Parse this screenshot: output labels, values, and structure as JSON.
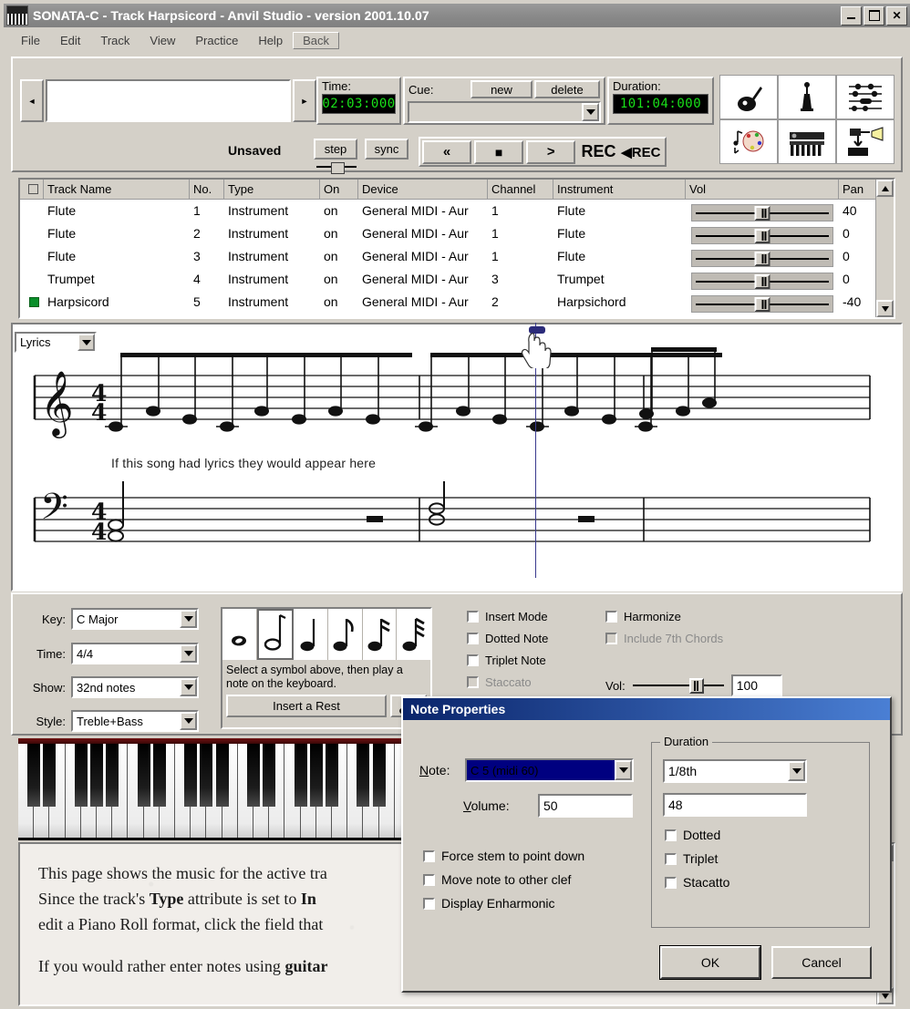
{
  "window": {
    "title": "SONATA-C - Track Harpsicord - Anvil Studio - version 2001.10.07",
    "icon": "piano-keyboard-icon",
    "minimize": "_",
    "maximize": "□",
    "close": "×"
  },
  "menu": {
    "items": [
      "File",
      "Edit",
      "Track",
      "View",
      "Practice",
      "Help"
    ],
    "back": "Back"
  },
  "toolbar": {
    "nav_prev": "◄",
    "nav_next": "►",
    "nav_value": "",
    "time_label": "Time:",
    "time_value": "02:03:000",
    "cue_label": "Cue:",
    "cue_new": "new",
    "cue_delete": "delete",
    "cue_value": "",
    "duration_label": "Duration:",
    "duration_value": "101:04:000",
    "unsaved": "Unsaved",
    "step": "step",
    "sync": "sync",
    "rewind": "«",
    "stop": "■",
    "play": ">",
    "rec": "REC",
    "rec_from_start": "◀REC",
    "icons": [
      "guitar-icon",
      "metronome-icon",
      "mixer-icon",
      "notes-palette-icon",
      "keyboard-icon",
      "export-icon"
    ]
  },
  "track_table": {
    "columns": [
      "",
      "Track Name",
      "No.",
      "Type",
      "On",
      "Device",
      "Channel",
      "Instrument",
      "Vol",
      "Pan"
    ],
    "rows": [
      {
        "active": false,
        "name": "Flute",
        "no": "1",
        "type": "Instrument",
        "on": "on",
        "device": "General MIDI - Aur",
        "channel": "1",
        "instrument": "Flute",
        "vol": 64,
        "pan": "40"
      },
      {
        "active": false,
        "name": "Flute",
        "no": "2",
        "type": "Instrument",
        "on": "on",
        "device": "General MIDI - Aur",
        "channel": "1",
        "instrument": "Flute",
        "vol": 64,
        "pan": "0"
      },
      {
        "active": false,
        "name": "Flute",
        "no": "3",
        "type": "Instrument",
        "on": "on",
        "device": "General MIDI - Aur",
        "channel": "1",
        "instrument": "Flute",
        "vol": 64,
        "pan": "0"
      },
      {
        "active": false,
        "name": "Trumpet",
        "no": "4",
        "type": "Instrument",
        "on": "on",
        "device": "General MIDI - Aur",
        "channel": "3",
        "instrument": "Trumpet",
        "vol": 64,
        "pan": "0"
      },
      {
        "active": true,
        "name": "Harpsicord",
        "no": "5",
        "type": "Instrument",
        "on": "on",
        "device": "General MIDI - Aur",
        "channel": "2",
        "instrument": "Harpsichord",
        "vol": 64,
        "pan": "-40"
      }
    ]
  },
  "score": {
    "view_select": "Lyrics",
    "lyrics": "If   this  song  had  lyrics  they  would  appear   here",
    "treble_clef": "treble-clef",
    "bass_clef": "bass-clef",
    "time_signature": "4/4",
    "cursor": "hand-cursor"
  },
  "controls": {
    "key_label": "Key:",
    "key_value": "C Major",
    "time_label": "Time:",
    "time_value": "4/4",
    "show_label": "Show:",
    "show_value": "32nd notes",
    "style_label": "Style:",
    "style_value": "Treble+Bass",
    "symbol_hint": "Select a symbol above, then play a note on the keyboard.",
    "insert_rest": "Insert a Rest",
    "symbols": [
      "whole-note",
      "half-note",
      "quarter-note",
      "eighth-note",
      "sixteenth-note",
      "thirtysecond-note"
    ],
    "selected_symbol_index": 1,
    "checkboxes_left": [
      {
        "label": "Insert Mode",
        "checked": false,
        "disabled": false
      },
      {
        "label": "Dotted Note",
        "checked": false,
        "disabled": false
      },
      {
        "label": "Triplet Note",
        "checked": false,
        "disabled": false
      },
      {
        "label": "Staccato",
        "checked": false,
        "disabled": true
      }
    ],
    "checkboxes_right": [
      {
        "label": "Harmonize",
        "checked": false,
        "disabled": false
      },
      {
        "label": "Include 7th Chords",
        "checked": false,
        "disabled": true
      }
    ],
    "vol_label": "Vol:",
    "vol_value": "100"
  },
  "dialog": {
    "title": "Note Properties",
    "note_label": "Note:",
    "note_value": "C 5 (midi 60)",
    "volume_label": "Volume:",
    "volume_value": "50",
    "duration_group": "Duration",
    "duration_value": "1/8th",
    "ticks_value": "48",
    "duration_checks": [
      {
        "label": "Dotted",
        "checked": false
      },
      {
        "label": "Triplet",
        "checked": false
      },
      {
        "label": "Stacatto",
        "checked": false
      }
    ],
    "left_checks": [
      {
        "label": "Force stem to point down",
        "checked": false
      },
      {
        "label": "Move note to other clef",
        "checked": false
      },
      {
        "label": "Display Enharmonic",
        "checked": false
      }
    ],
    "ok": "OK",
    "cancel": "Cancel"
  },
  "help": {
    "line1_a": "This page shows the music for the active tra",
    "line2_a": "Since the track's ",
    "line2_b": "Type",
    "line2_c": " attribute is set to ",
    "line2_d": "In",
    "line3_a": "edit a Piano Roll format, click the field that ",
    "line4_a": "If you would rather enter notes using ",
    "line4_b": "guitar"
  },
  "colors": {
    "face": "#d4d0c8",
    "lcd_bg": "#000000",
    "lcd_fg": "#19e019",
    "dialog_title": "#0a246a",
    "active_dot": "#0a8f2a"
  }
}
